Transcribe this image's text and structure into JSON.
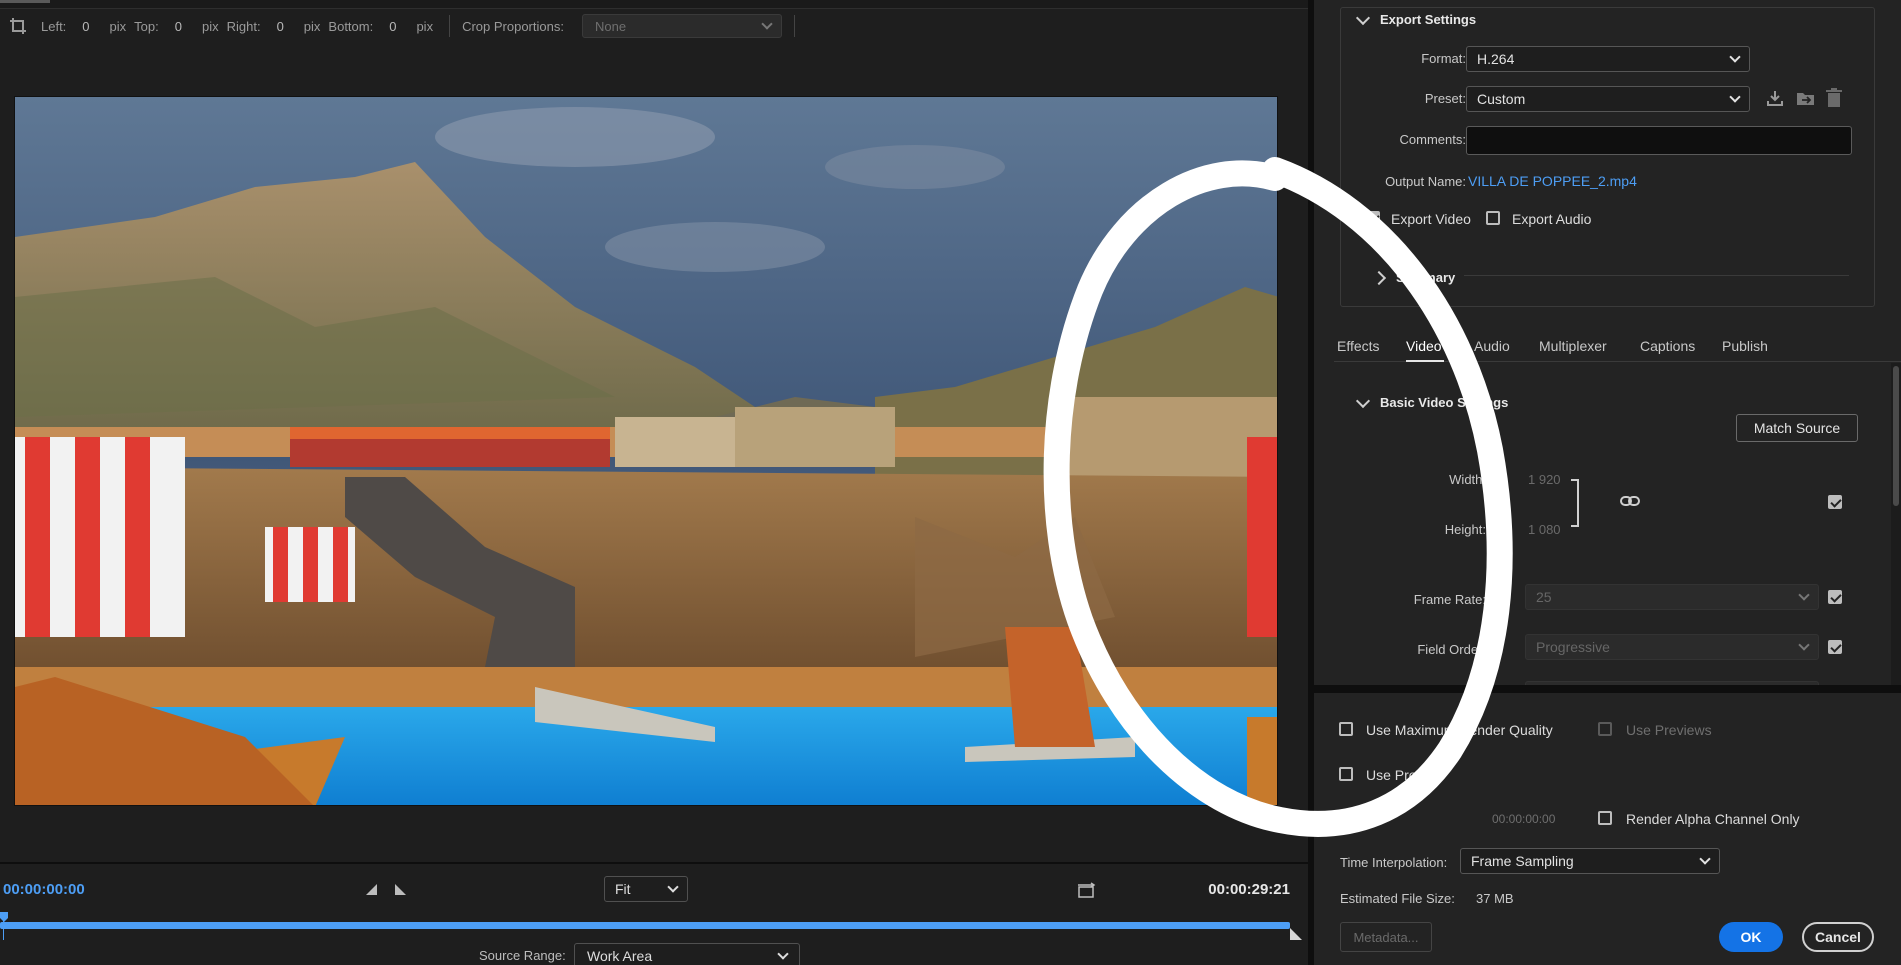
{
  "crop": {
    "left_label": "Left:",
    "left_value": "0",
    "left_unit": "pix",
    "top_label": "Top:",
    "top_value": "0",
    "top_unit": "pix",
    "right_label": "Right:",
    "right_value": "0",
    "right_unit": "pix",
    "bottom_label": "Bottom:",
    "bottom_value": "0",
    "bottom_unit": "pix",
    "proportions_label": "Crop Proportions:",
    "proportions_value": "None"
  },
  "preview": {
    "current_time": "00:00:00:00",
    "duration": "00:00:29:21",
    "zoom": "Fit",
    "playhead_position": 0.0,
    "source_range_label": "Source Range:",
    "source_range_value": "Work Area"
  },
  "export_settings": {
    "title": "Export Settings",
    "format_label": "Format:",
    "format_value": "H.264",
    "preset_label": "Preset:",
    "preset_value": "Custom",
    "comments_label": "Comments:",
    "comments_value": "",
    "output_name_label": "Output Name:",
    "output_name_value": "VILLA DE POPPEE_2.mp4",
    "export_video_label": "Export Video",
    "export_video_checked": true,
    "export_audio_label": "Export Audio",
    "export_audio_checked": false,
    "summary_label": "Summary"
  },
  "tabs": [
    {
      "label": "Effects",
      "active": false
    },
    {
      "label": "Video",
      "active": true
    },
    {
      "label": "Audio",
      "active": false
    },
    {
      "label": "Multiplexer",
      "active": false
    },
    {
      "label": "Captions",
      "active": false
    },
    {
      "label": "Publish",
      "active": false
    }
  ],
  "video": {
    "section_title": "Basic Video Settings",
    "match_source_label": "Match Source",
    "width_label": "Width:",
    "width_value": "1 920",
    "height_label": "Height:",
    "height_value": "1 080",
    "frame_rate_label": "Frame Rate:",
    "frame_rate_value": "25",
    "field_order_label": "Field Order:",
    "field_order_value": "Progressive"
  },
  "render": {
    "max_quality_label": "Use Maximum Render Quality",
    "max_quality_checked": false,
    "use_previews_label": "Use Previews",
    "use_previews_checked": false,
    "use_proxies_label": "Use Proxies",
    "use_proxies_checked": false,
    "start_timecode_value": "00:00:00:00",
    "alpha_only_label": "Render Alpha Channel Only",
    "alpha_only_checked": false,
    "time_interp_label": "Time Interpolation:",
    "time_interp_value": "Frame Sampling",
    "file_size_label": "Estimated File Size:",
    "file_size_value": "37 MB"
  },
  "buttons": {
    "metadata": "Metadata...",
    "ok": "OK",
    "cancel": "Cancel"
  },
  "colors": {
    "accent": "#4d9ef5",
    "ok_button": "#1473e6"
  }
}
